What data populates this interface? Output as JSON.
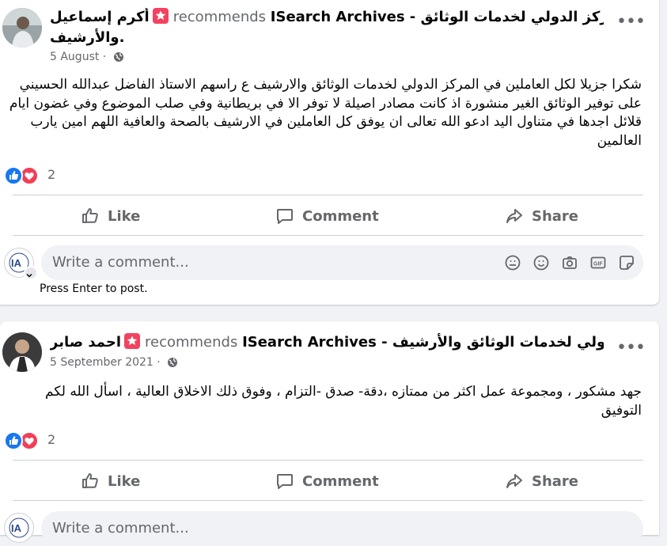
{
  "posts": [
    {
      "author": "أكرم إسماعيل",
      "recommends": "recommends",
      "page": "ISearch Archives - المركز الدولي لخدمات الوثائق",
      "page_cont": "والأرشيف.",
      "date": "5 August",
      "text": "شكرا جزيلا لكل العاملين في المركز الدولي لخدمات الوثائق والارشيف ع راسهم الاستاذ الفاضل عبدالله الحسيني على توفير الوثائق الغير منشورة اذ كانت مصادر اصيلة لا توفر الا في بريطانية وفي صلب الموضوع وفي غضون ايام قلائل اجدها في متناول اليد ادعو الله تعالى ان يوفق كل العاملين في الارشيف بالصحة والعافية اللهم امين يارب العالمين",
      "reactions_count": "2",
      "like_label": "Like",
      "comment_label": "Comment",
      "share_label": "Share",
      "comment_placeholder": "Write a comment...",
      "hint": "Press Enter to post."
    },
    {
      "author": "احمد صابر",
      "recommends": "recommends",
      "page": "ISearch Archives - المركز الدولي لخدمات الوثائق والأرشيف.",
      "date": "5 September 2021",
      "text": "جهد مشكور ، ومجموعة عمل اكثر من ممتازه ،دقة- صدق -التزام ، وفوق ذلك الاخلاق العالية ، اسأل الله لكم التوفيق",
      "reactions_count": "2",
      "like_label": "Like",
      "comment_label": "Comment",
      "share_label": "Share",
      "comment_placeholder": "Write a comment..."
    }
  ],
  "colors": {
    "like_blue": "#1877f2",
    "love_red": "#f33e58",
    "recommend_red": "#f3425f",
    "muted_text": "#65676b",
    "background": "#f0f2f5"
  },
  "icons": {
    "recommend": "star-badge-icon",
    "audience": "globe-icon",
    "menu": "more-dots-icon",
    "like": "thumbs-up-icon",
    "comment": "speech-bubble-icon",
    "share": "share-arrow-icon"
  }
}
